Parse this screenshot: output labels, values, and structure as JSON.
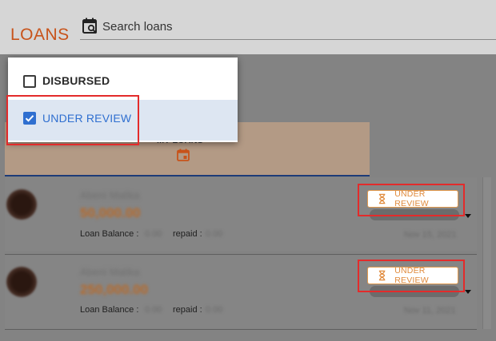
{
  "header": {
    "brand": "LOANS",
    "search_placeholder": "Search loans"
  },
  "tabs": {
    "active_label": "MY LOANS"
  },
  "filter_menu": {
    "items": [
      {
        "label": "DISBURSED",
        "checked": false
      },
      {
        "label": "UNDER REVIEW",
        "checked": true
      }
    ]
  },
  "loans": [
    {
      "name": "Abeni Malika",
      "amount": "50,000.00",
      "balance_label": "Loan Balance :",
      "balance_value": "0.00",
      "repaid_label": "repaid :",
      "repaid_value": "0.00",
      "status": "UNDER REVIEW",
      "date": "Nov 15, 2021"
    },
    {
      "name": "Abeni Malika",
      "amount": "250,000.00",
      "balance_label": "Loan Balance :",
      "balance_value": "0.00",
      "repaid_label": "repaid :",
      "repaid_value": "0.00",
      "status": "UNDER REVIEW",
      "date": "Nov 11, 2021"
    }
  ],
  "colors": {
    "brand": "#c8531a",
    "status": "#e08a3c",
    "highlight_frame": "#e32b2b",
    "selected_check": "#2f6fd0"
  }
}
